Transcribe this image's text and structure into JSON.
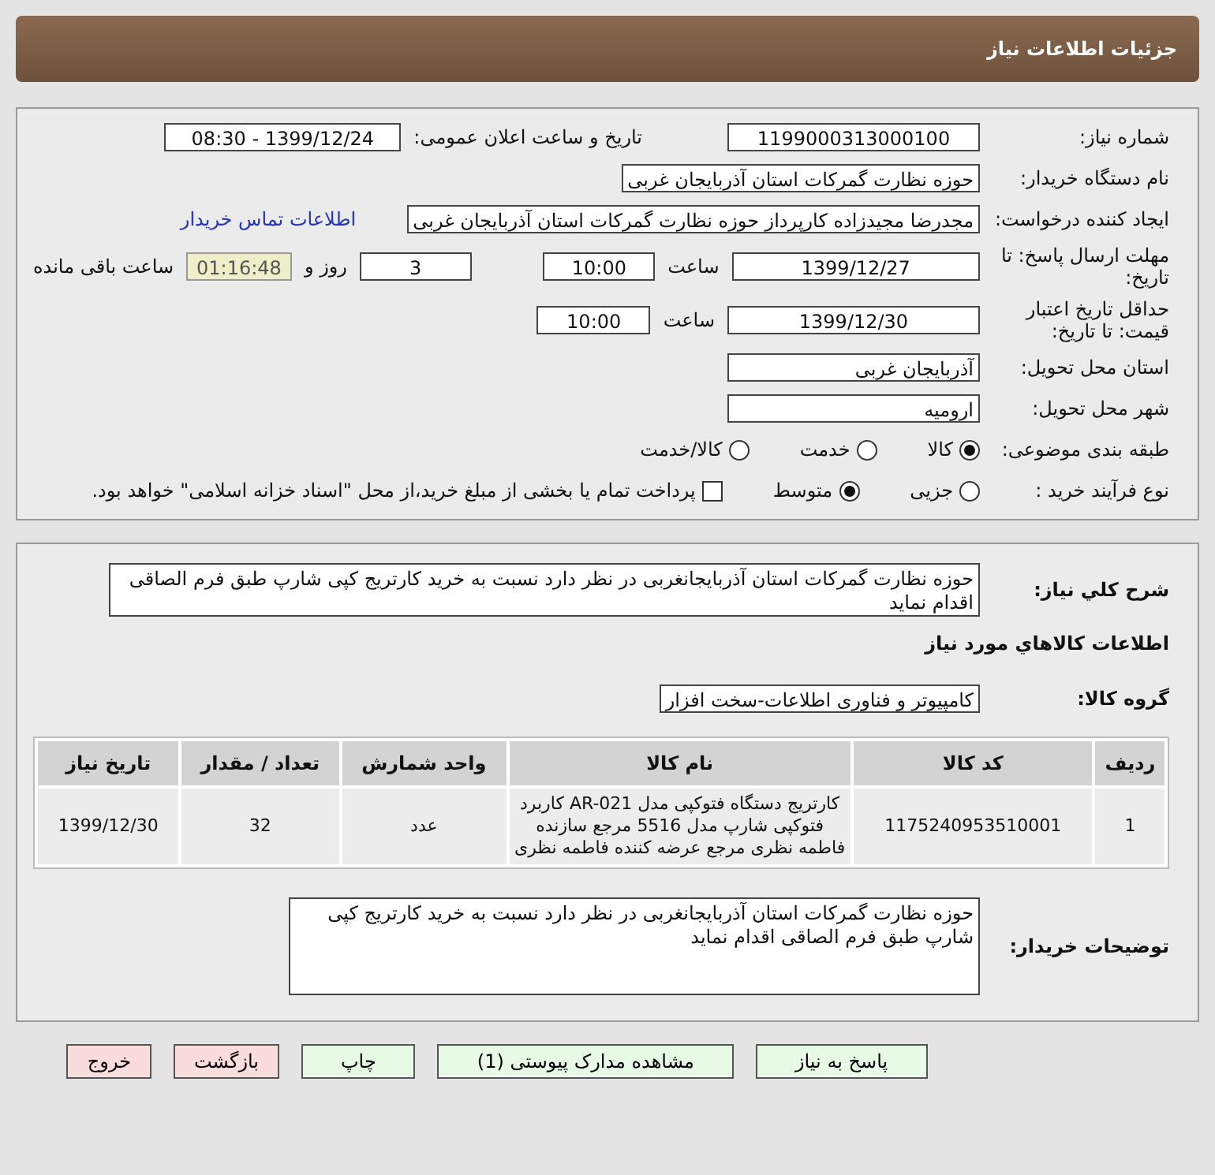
{
  "header": {
    "title": "جزئیات اطلاعات نیاز"
  },
  "need_number": {
    "label": "شماره نیاز:",
    "value": "1199000313000100"
  },
  "announce": {
    "label": "تاریخ و ساعت اعلان عمومی:",
    "value": "1399/12/24 - 08:30"
  },
  "buyer_org": {
    "label": "نام دستگاه خریدار:",
    "value": "حوزه نظارت گمرکات استان آذربایجان غربی"
  },
  "requester": {
    "label": "ایجاد کننده درخواست:",
    "value": "مجدرضا مجیدزاده کارپرداز حوزه نظارت گمرکات استان آذربایجان غربی",
    "link": "اطلاعات تماس خریدار"
  },
  "deadline": {
    "label": "مهلت ارسال پاسخ: تا تاریخ:",
    "date": "1399/12/27",
    "time_label": "ساعت",
    "time": "10:00",
    "days": "3",
    "days_label": "روز و",
    "remaining": "01:16:48",
    "remaining_label": "ساعت باقی مانده"
  },
  "validity": {
    "label": "حداقل تاریخ اعتبار قیمت: تا تاریخ:",
    "date": "1399/12/30",
    "time_label": "ساعت",
    "time": "10:00"
  },
  "province": {
    "label": "استان محل تحویل:",
    "value": "آذربایجان غربی"
  },
  "city": {
    "label": "شهر محل تحویل:",
    "value": "ارومیه"
  },
  "category": {
    "label": "طبقه بندی موضوعی:",
    "options": [
      {
        "label": "کالا",
        "selected": true
      },
      {
        "label": "خدمت",
        "selected": false
      },
      {
        "label": "کالا/خدمت",
        "selected": false
      }
    ]
  },
  "process": {
    "label": "نوع فرآیند خرید :",
    "options": [
      {
        "label": "جزیی",
        "selected": false
      },
      {
        "label": "متوسط",
        "selected": true
      }
    ],
    "payment": {
      "checked": false,
      "text": "پرداخت تمام یا بخشی از مبلغ خرید،از محل \"اسناد خزانه اسلامی\" خواهد بود."
    }
  },
  "description": {
    "label": "شرح کلي نياز:",
    "value": "حوزه نظارت گمرکات استان آذربایجانغربی در نظر دارد نسبت به خرید کارتریج کپی شارپ طبق فرم الصاقی اقدام نماید"
  },
  "goods_heading": "اطلاعات کالاهاي مورد نياز",
  "goods_group": {
    "label": "گروه کالا:",
    "value": "کامپیوتر و فناوری اطلاعات-سخت افزار"
  },
  "table": {
    "columns": [
      "ردیف",
      "کد کالا",
      "نام کالا",
      "واحد شمارش",
      "تعداد / مقدار",
      "تاریخ نیاز"
    ],
    "rows": [
      [
        "1",
        "1175240953510001",
        "کارتریج دستگاه فتوکپی مدل AR-021 کاربرد فتوکپی شارپ مدل 5516 مرجع سازنده فاطمه نظری مرجع عرضه کننده فاطمه نظری",
        "عدد",
        "32",
        "1399/12/30"
      ]
    ]
  },
  "buyer_notes": {
    "label": "توضیحات خریدار:",
    "value": "حوزه نظارت گمرکات استان آذربایجانغربی در نظر دارد نسبت به خرید کارتریج کپی شارپ طبق فرم الصاقی اقدام نماید"
  },
  "buttons": [
    {
      "label": "پاسخ به نیاز",
      "kind": "action"
    },
    {
      "label": "مشاهده مدارک پیوستی (1)",
      "kind": "action"
    },
    {
      "label": "چاپ",
      "kind": "action"
    },
    {
      "label": "بازگشت",
      "kind": "exit"
    },
    {
      "label": "خروج",
      "kind": "exit"
    }
  ]
}
